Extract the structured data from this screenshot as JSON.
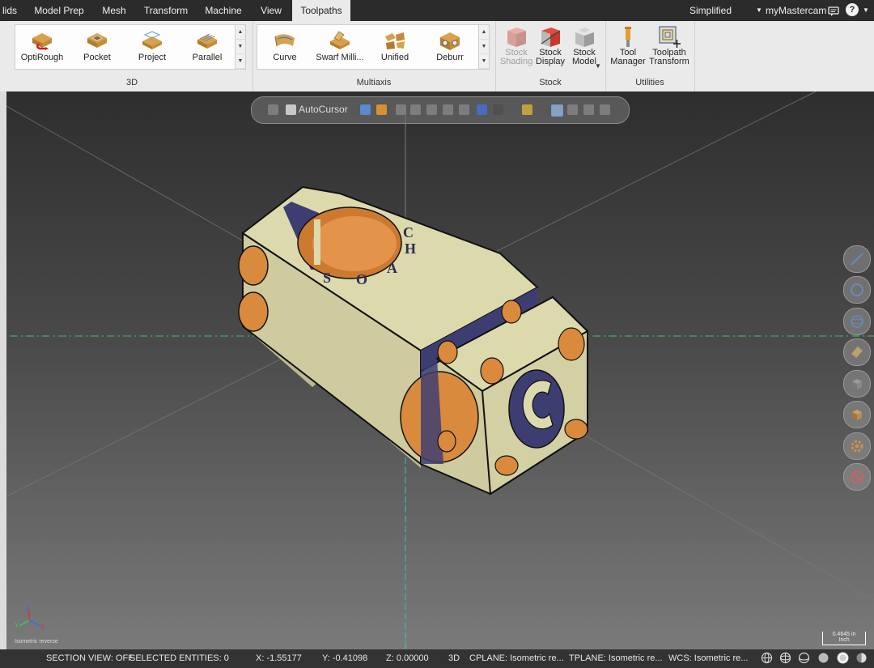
{
  "menu": {
    "tabs": [
      "lids",
      "Model Prep",
      "Mesh",
      "Transform",
      "Machine",
      "View",
      "Toolpaths"
    ],
    "active_tab": "Toolpaths",
    "mode": "Simplified",
    "account": "myMastercam"
  },
  "ribbon": {
    "group_3d": {
      "label": "3D",
      "buttons": [
        "OptiRough",
        "Pocket",
        "Project",
        "Parallel"
      ]
    },
    "group_multiaxis": {
      "label": "Multiaxis",
      "buttons": [
        "Curve",
        "Swarf Milli...",
        "Unified",
        "Deburr"
      ]
    },
    "group_stock": {
      "label": "Stock",
      "stock_shading": "Stock\nShading",
      "stock_display": "Stock\nDisplay",
      "stock_model": "Stock\nModel"
    },
    "group_utilities": {
      "label": "Utilities",
      "tool_manager": "Tool\nManager",
      "toolpath_transform": "Toolpath\nTransform"
    }
  },
  "viewport": {
    "autocursor": "AutoCursor",
    "view_name": "Isometric reverse",
    "scale_value": "0.4645 in",
    "scale_unit": "Inch",
    "engraved_text": [
      "C",
      "H",
      "A",
      "O",
      "S"
    ]
  },
  "status": {
    "section_view": "SECTION VIEW: OFF",
    "selected": "SELECTED ENTITIES: 0",
    "x": "X:   -1.55177",
    "y": "Y:   -0.41098",
    "z": "Z:   0.00000",
    "mode3d": "3D",
    "cplane": "CPLANE: Isometric re...",
    "tplane": "TPLANE: Isometric re...",
    "wcs": "WCS: Isometric re..."
  },
  "colors": {
    "part_body": "#d6d3a6",
    "bore": "#d98a3c",
    "cut_face": "#3e3d72",
    "axis_green": "#33cc66",
    "axis_red": "#e03030",
    "axis_cyan": "#2bc6d6"
  }
}
